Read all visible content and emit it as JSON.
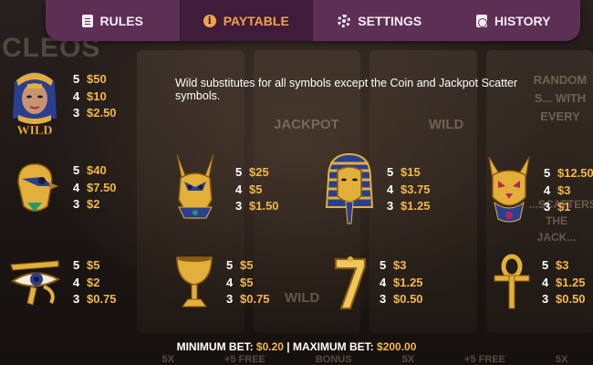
{
  "tabs": [
    {
      "label": "RULES",
      "icon": "document-icon",
      "active": false
    },
    {
      "label": "PAYTABLE",
      "icon": "info-icon",
      "active": true
    },
    {
      "label": "SETTINGS",
      "icon": "gear-icon",
      "active": false
    },
    {
      "label": "HISTORY",
      "icon": "history-icon",
      "active": false
    }
  ],
  "wild_note": "Wild substitutes for all symbols except the Coin and Jackpot Scatter symbols.",
  "symbols": {
    "cleopatra_wild": {
      "icon": "cleopatra-wild-icon",
      "label": "WILD",
      "pays": [
        {
          "count": "5",
          "amount": "$50"
        },
        {
          "count": "4",
          "amount": "$10"
        },
        {
          "count": "3",
          "amount": "$2.50"
        }
      ]
    },
    "horus": {
      "icon": "horus-falcon-icon",
      "pays": [
        {
          "count": "5",
          "amount": "$40"
        },
        {
          "count": "4",
          "amount": "$7.50"
        },
        {
          "count": "3",
          "amount": "$2"
        }
      ]
    },
    "anubis": {
      "icon": "anubis-icon",
      "pays": [
        {
          "count": "5",
          "amount": "$25"
        },
        {
          "count": "4",
          "amount": "$5"
        },
        {
          "count": "3",
          "amount": "$1.50"
        }
      ]
    },
    "pharaoh": {
      "icon": "pharaoh-mask-icon",
      "pays": [
        {
          "count": "5",
          "amount": "$15"
        },
        {
          "count": "4",
          "amount": "$3.75"
        },
        {
          "count": "3",
          "amount": "$1.25"
        }
      ]
    },
    "bastet": {
      "icon": "bastet-cat-icon",
      "pays": [
        {
          "count": "5",
          "amount": "$12.50"
        },
        {
          "count": "4",
          "amount": "$3"
        },
        {
          "count": "3",
          "amount": "$1"
        }
      ]
    },
    "eye": {
      "icon": "eye-of-horus-icon",
      "pays": [
        {
          "count": "5",
          "amount": "$5"
        },
        {
          "count": "4",
          "amount": "$2"
        },
        {
          "count": "3",
          "amount": "$0.75"
        }
      ]
    },
    "chalice": {
      "icon": "chalice-icon",
      "pays": [
        {
          "count": "5",
          "amount": "$5"
        },
        {
          "count": "4",
          "amount": "$5"
        },
        {
          "count": "3",
          "amount": "$0.75"
        }
      ]
    },
    "seven": {
      "icon": "seven-icon",
      "pays": [
        {
          "count": "5",
          "amount": "$3"
        },
        {
          "count": "4",
          "amount": "$1.25"
        },
        {
          "count": "3",
          "amount": "$0.50"
        }
      ]
    },
    "ankh": {
      "icon": "ankh-icon",
      "pays": [
        {
          "count": "5",
          "amount": "$3"
        },
        {
          "count": "4",
          "amount": "$1.25"
        },
        {
          "count": "3",
          "amount": "$0.50"
        }
      ]
    }
  },
  "footer": {
    "min_label": "MINIMUM BET:",
    "min_value": "$0.20",
    "separator": "|",
    "max_label": "MAXIMUM BET:",
    "max_value": "$200.00"
  },
  "background": {
    "title": "CLEOS",
    "jackpot": "JACKPOT",
    "wild_1": "WILD",
    "wild_2": "WILD",
    "side_text_1": "RANDOM S... WITH EVERY",
    "side_text_2": "...SCATTERS THE JACK...",
    "bottom_labels": [
      "5X",
      "+5 FREE",
      "BONUS",
      "5X",
      "+5 FREE",
      "5X"
    ]
  },
  "colors": {
    "tab_bar": "#5d2f55",
    "tab_active": "#3e1c3a",
    "accent": "#f2a24a",
    "amount": "#f2b84a"
  }
}
